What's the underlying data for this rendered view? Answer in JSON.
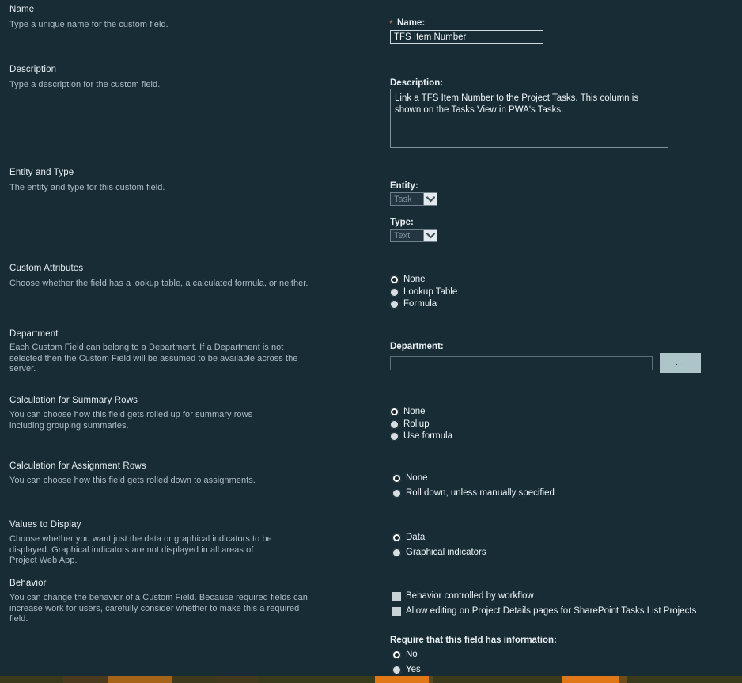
{
  "sections": [
    {
      "id": "name",
      "title": "Name",
      "description": "Type a unique name for the custom field."
    },
    {
      "id": "description",
      "title": "Description",
      "description": "Type a description for the custom field."
    },
    {
      "id": "entity-and-type",
      "title": "Entity and Type",
      "description": "The entity and type for this custom field."
    },
    {
      "id": "custom-attributes",
      "title": "Custom Attributes",
      "description": "Choose whether the field has a lookup table, a calculated formula, or neither."
    },
    {
      "id": "department",
      "title": "Department",
      "description": "Each Custom Field can belong to a Department. If a Department is not selected then the Custom Field will be assumed to be available across the server."
    },
    {
      "id": "calculation-summary-rows",
      "title": "Calculation for Summary Rows",
      "description": "You can choose how this field gets rolled up for summary rows including grouping summaries."
    },
    {
      "id": "calculation-assignment-rows",
      "title": "Calculation for Assignment Rows",
      "description": "You can choose how this field gets rolled down to assignments."
    },
    {
      "id": "values-to-display",
      "title": "Values to Display",
      "description": "Choose whether you want just the data or graphical indicators to be displayed. Graphical indicators are not displayed in all areas of Project Web App."
    },
    {
      "id": "behavior",
      "title": "Behavior",
      "description": "You can change the behavior of a Custom Field. Because required fields can increase work for users, carefully consider whether to make this a required field."
    }
  ],
  "fields": {
    "name": {
      "label": "Name:",
      "required_marker": "*",
      "value": "TFS Item Number",
      "placeholder": ""
    },
    "description": {
      "label": "Description:",
      "value": "Link a TFS Item Number to the Project Tasks. This column is shown on the Tasks View in PWA's Tasks.",
      "placeholder": ""
    },
    "entity": {
      "label": "Entity:",
      "value": "Task",
      "disabled": true
    },
    "type": {
      "label": "Type:",
      "value": "Text",
      "disabled": true
    },
    "department": {
      "label": "Department:",
      "value": "",
      "placeholder": "",
      "browse_button_label": "..."
    },
    "require_information": {
      "label": "Require that this field has information:"
    }
  },
  "custom_attributes_options": [
    {
      "label": "None",
      "selected": true
    },
    {
      "label": "Lookup Table",
      "selected": false
    },
    {
      "label": "Formula",
      "selected": false
    }
  ],
  "summary_rows_options": [
    {
      "label": "None",
      "selected": true
    },
    {
      "label": "Rollup",
      "selected": false
    },
    {
      "label": "Use formula",
      "selected": false
    }
  ],
  "assignment_rows_options": [
    {
      "label": "None",
      "selected": true
    },
    {
      "label": "Roll down, unless manually specified",
      "selected": false
    }
  ],
  "values_to_display_options": [
    {
      "label": "Data",
      "selected": true
    },
    {
      "label": "Graphical indicators",
      "selected": false
    }
  ],
  "behavior_checkboxes": [
    {
      "label": "Behavior controlled by workflow",
      "checked": false
    },
    {
      "label": "Allow editing on Project Details pages for SharePoint Tasks List Projects",
      "checked": false
    }
  ],
  "require_information_options": [
    {
      "label": "No",
      "selected": true
    },
    {
      "label": "Yes",
      "selected": false
    }
  ],
  "colors": {
    "background": "#182c36",
    "heading_text": "#e8eef1",
    "body_text": "#aebcc4",
    "required_star": "#e0655a",
    "input_border": "#cfd9de",
    "browse_button": "#adc5c9",
    "accent_orange": "#e07818"
  }
}
